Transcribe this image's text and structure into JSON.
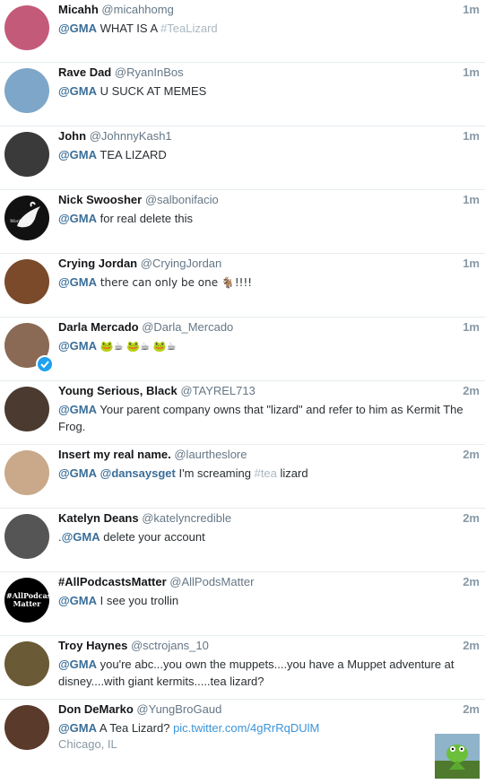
{
  "tweets": [
    {
      "name": "Micahh",
      "handle": "@micahhomg",
      "time": "1m",
      "mention": "@GMA",
      "text": " WHAT IS A ",
      "hashtag": "#TeaLizard",
      "avatar_color": "#c45a7a"
    },
    {
      "name": "Rave Dad",
      "handle": "@RyanInBos",
      "time": "1m",
      "mention": "@GMA",
      "text": " U SUCK AT MEMES",
      "avatar_color": "#7da6c8"
    },
    {
      "name": "John",
      "handle": "@JohnnyKash1",
      "time": "1m",
      "mention": "@GMA",
      "text": " TEA LIZARD",
      "avatar_color": "#3a3a3a"
    },
    {
      "name": "Nick Swoosher",
      "handle": "@salbonifacio",
      "time": "1m",
      "mention": "@GMA",
      "text": " for real delete this",
      "avatar_color": "#111111",
      "avatar_text": "Work City"
    },
    {
      "name": "Crying Jordan",
      "handle": "@CryingJordan",
      "time": "1m",
      "mention": "@GMA",
      "text": " there can only be one 🐐!!!!",
      "avatar_color": "#7a4a2a"
    },
    {
      "name": "Darla Mercado",
      "handle": "@Darla_Mercado",
      "time": "1m",
      "mention": "@GMA",
      "text": " 🐸☕ 🐸☕ 🐸☕",
      "avatar_color": "#8a6a55"
    },
    {
      "name": "Young Serious, Black",
      "handle": "@TAYREL713",
      "time": "2m",
      "mention": "@GMA",
      "text": " Your parent company owns that \"lizard\" and refer to him as Kermit The Frog.",
      "avatar_color": "#4a3a30"
    },
    {
      "name": "Insert my real name.",
      "handle": "@laurtheslore",
      "time": "2m",
      "mention": "@GMA",
      "mention2": "@dansaysget",
      "text": " I'm screaming ",
      "hashtag": "#tea",
      "text_after": " lizard",
      "avatar_color": "#c9a98a"
    },
    {
      "name": "Katelyn Deans",
      "handle": "@katelyncredible",
      "time": "2m",
      "prefix": ".",
      "mention": "@GMA",
      "text": " delete your account",
      "avatar_color": "#555555"
    },
    {
      "name": "#AllPodcastsMatter",
      "handle": "@AllPodsMatter",
      "time": "2m",
      "mention": "@GMA",
      "text": " I see you trollin",
      "avatar_color": "#000000",
      "avatar_text": "#AllPodcasts Matter"
    },
    {
      "name": "Troy Haynes",
      "handle": "@sctrojans_10",
      "time": "2m",
      "mention": "@GMA",
      "text": " you're abc...you own the muppets....you have a Muppet adventure at disney....with giant kermits.....tea lizard?",
      "avatar_color": "#6a5a35"
    },
    {
      "name": "Don DeMarko",
      "handle": "@YungBroGaud",
      "time": "2m",
      "mention": "@GMA",
      "text": " A Tea Lizard? ",
      "link": "pic.twitter.com/4gRrRqDUlM",
      "location": "Chicago, IL",
      "avatar_color": "#5a3a2a"
    }
  ],
  "colors": {
    "mention": "#3b6e98",
    "hashtag": "#aab8c2",
    "link": "#3b94d9",
    "verified": "#1da1f2"
  }
}
